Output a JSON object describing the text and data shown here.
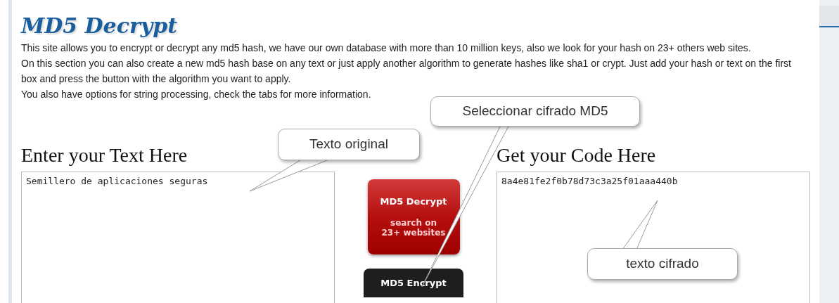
{
  "title": "MD5 Decrypt",
  "intro": [
    "This site allows you to encrypt or decrypt any md5 hash, we have our own database with more than 10 million keys, also we look for your hash on 23+ others web sites.",
    "On this section you can also create a new md5 hash base on any text or just apply another algorithm to generate hashes like sha1 or crypt. Just add your hash or text on the first box and press the button with the algorithm you want to apply.",
    "You also have options for string processing, check the tabs for more information."
  ],
  "input_panel": {
    "heading": "Enter your Text Here",
    "value": "Semillero de aplicaciones seguras"
  },
  "buttons": [
    {
      "kind": "decrypt",
      "label": "MD5 Decrypt",
      "sublines": [
        "search on",
        "23+ websites"
      ]
    },
    {
      "kind": "encrypt",
      "label": "MD5 Encrypt"
    }
  ],
  "output_panel": {
    "heading": "Get your Code Here",
    "value": "8a4e81fe2f0b78d73c3a25f01aaa440b"
  },
  "callouts": [
    {
      "text": "Texto original"
    },
    {
      "text": "Seleccionar cifrado MD5"
    },
    {
      "text": "texto cifrado"
    }
  ]
}
